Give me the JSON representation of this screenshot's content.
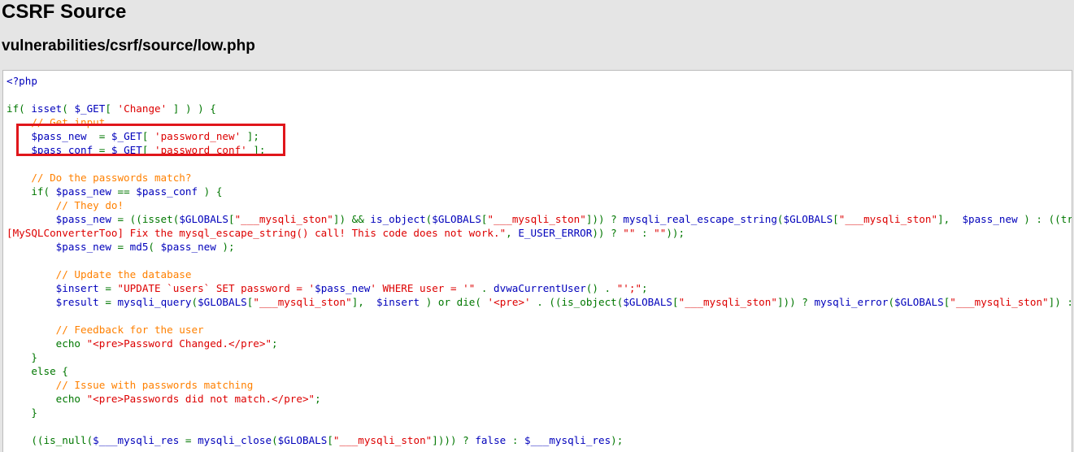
{
  "page": {
    "title": "CSRF Source",
    "file_path": "vulnerabilities/csrf/source/low.php"
  },
  "code": {
    "lines": [
      [
        [
          "default",
          "<?php"
        ]
      ],
      [],
      [
        [
          "keyword",
          "if( "
        ],
        [
          "default",
          "isset"
        ],
        [
          "keyword",
          "( "
        ],
        [
          "default",
          "$_GET"
        ],
        [
          "keyword",
          "[ "
        ],
        [
          "string",
          "'Change'"
        ],
        [
          "keyword",
          " ] ) ) {"
        ]
      ],
      [
        [
          "comment",
          "    // Get input"
        ]
      ],
      [
        [
          "default",
          "    $pass_new  "
        ],
        [
          "keyword",
          "= "
        ],
        [
          "default",
          "$_GET"
        ],
        [
          "keyword",
          "[ "
        ],
        [
          "string",
          "'password_new'"
        ],
        [
          "keyword",
          " ];"
        ]
      ],
      [
        [
          "default",
          "    $pass_conf "
        ],
        [
          "keyword",
          "= "
        ],
        [
          "default",
          "$_GET"
        ],
        [
          "keyword",
          "[ "
        ],
        [
          "string",
          "'password_conf'"
        ],
        [
          "keyword",
          " ];"
        ]
      ],
      [],
      [
        [
          "comment",
          "    // Do the passwords match?"
        ]
      ],
      [
        [
          "keyword",
          "    if( "
        ],
        [
          "default",
          "$pass_new "
        ],
        [
          "keyword",
          "== "
        ],
        [
          "default",
          "$pass_conf "
        ],
        [
          "keyword",
          ") {"
        ]
      ],
      [
        [
          "comment",
          "        // They do!"
        ]
      ],
      [
        [
          "default",
          "        $pass_new "
        ],
        [
          "keyword",
          "= ((isset("
        ],
        [
          "default",
          "$GLOBALS"
        ],
        [
          "keyword",
          "["
        ],
        [
          "string",
          "\"___mysqli_ston\""
        ],
        [
          "keyword",
          "]) && "
        ],
        [
          "default",
          "is_object"
        ],
        [
          "keyword",
          "("
        ],
        [
          "default",
          "$GLOBALS"
        ],
        [
          "keyword",
          "["
        ],
        [
          "string",
          "\"___mysqli_ston\""
        ],
        [
          "keyword",
          "])) ? "
        ],
        [
          "default",
          "mysqli_real_escape_string"
        ],
        [
          "keyword",
          "("
        ],
        [
          "default",
          "$GLOBALS"
        ],
        [
          "keyword",
          "["
        ],
        [
          "string",
          "\"___mysqli_ston\""
        ],
        [
          "keyword",
          "],  "
        ],
        [
          "default",
          "$pass_new "
        ],
        [
          "keyword",
          ") : ((trigger_error("
        ],
        [
          "string",
          "\"["
        ]
      ],
      [
        [
          "string",
          "[MySQLConverterToo] Fix the mysql_escape_string() call! This code does not work.\""
        ],
        [
          "keyword",
          ", "
        ],
        [
          "default",
          "E_USER_ERROR"
        ],
        [
          "keyword",
          ")) ? "
        ],
        [
          "string",
          "\"\""
        ],
        [
          "keyword",
          " : "
        ],
        [
          "string",
          "\"\""
        ],
        [
          "keyword",
          "));"
        ]
      ],
      [
        [
          "default",
          "        $pass_new "
        ],
        [
          "keyword",
          "= "
        ],
        [
          "default",
          "md5"
        ],
        [
          "keyword",
          "( "
        ],
        [
          "default",
          "$pass_new "
        ],
        [
          "keyword",
          ");"
        ]
      ],
      [],
      [
        [
          "comment",
          "        // Update the database"
        ]
      ],
      [
        [
          "default",
          "        $insert "
        ],
        [
          "keyword",
          "= "
        ],
        [
          "string",
          "\"UPDATE `users` SET password = '"
        ],
        [
          "default",
          "$pass_new"
        ],
        [
          "string",
          "' WHERE user = '\""
        ],
        [
          "keyword",
          " . "
        ],
        [
          "default",
          "dvwaCurrentUser"
        ],
        [
          "keyword",
          "() . "
        ],
        [
          "string",
          "\"';\""
        ],
        [
          "keyword",
          ";"
        ]
      ],
      [
        [
          "default",
          "        $result "
        ],
        [
          "keyword",
          "= "
        ],
        [
          "default",
          "mysqli_query"
        ],
        [
          "keyword",
          "("
        ],
        [
          "default",
          "$GLOBALS"
        ],
        [
          "keyword",
          "["
        ],
        [
          "string",
          "\"___mysqli_ston\""
        ],
        [
          "keyword",
          "],  "
        ],
        [
          "default",
          "$insert "
        ],
        [
          "keyword",
          ") or die( "
        ],
        [
          "string",
          "'<pre>'"
        ],
        [
          "keyword",
          " . ((is_object("
        ],
        [
          "default",
          "$GLOBALS"
        ],
        [
          "keyword",
          "["
        ],
        [
          "string",
          "\"___mysqli_ston\""
        ],
        [
          "keyword",
          "])) ? "
        ],
        [
          "default",
          "mysqli_error"
        ],
        [
          "keyword",
          "("
        ],
        [
          "default",
          "$GLOBALS"
        ],
        [
          "keyword",
          "["
        ],
        [
          "string",
          "\"___mysqli_ston\""
        ],
        [
          "keyword",
          "]) : (("
        ]
      ],
      [],
      [
        [
          "comment",
          "        // Feedback for the user"
        ]
      ],
      [
        [
          "keyword",
          "        echo "
        ],
        [
          "string",
          "\"<pre>Password Changed.</pre>\""
        ],
        [
          "keyword",
          ";"
        ]
      ],
      [
        [
          "keyword",
          "    }"
        ]
      ],
      [
        [
          "keyword",
          "    else {"
        ]
      ],
      [
        [
          "comment",
          "        // Issue with passwords matching"
        ]
      ],
      [
        [
          "keyword",
          "        echo "
        ],
        [
          "string",
          "\"<pre>Passwords did not match.</pre>\""
        ],
        [
          "keyword",
          ";"
        ]
      ],
      [
        [
          "keyword",
          "    }"
        ]
      ],
      [],
      [
        [
          "keyword",
          "    ((is_null("
        ],
        [
          "default",
          "$___mysqli_res "
        ],
        [
          "keyword",
          "= "
        ],
        [
          "default",
          "mysqli_close"
        ],
        [
          "keyword",
          "("
        ],
        [
          "default",
          "$GLOBALS"
        ],
        [
          "keyword",
          "["
        ],
        [
          "string",
          "\"___mysqli_ston\""
        ],
        [
          "keyword",
          "]))) ? "
        ],
        [
          "default",
          "false "
        ],
        [
          "keyword",
          ": "
        ],
        [
          "default",
          "$___mysqli_res"
        ],
        [
          "keyword",
          ");"
        ]
      ]
    ]
  },
  "highlight": {
    "color": "#e0161b",
    "covers_lines": [
      5,
      6
    ]
  },
  "colors": {
    "default": "#0000bb",
    "keyword": "#007700",
    "string": "#dd0000",
    "comment": "#ff8000",
    "page_background": "#e5e5e5"
  }
}
